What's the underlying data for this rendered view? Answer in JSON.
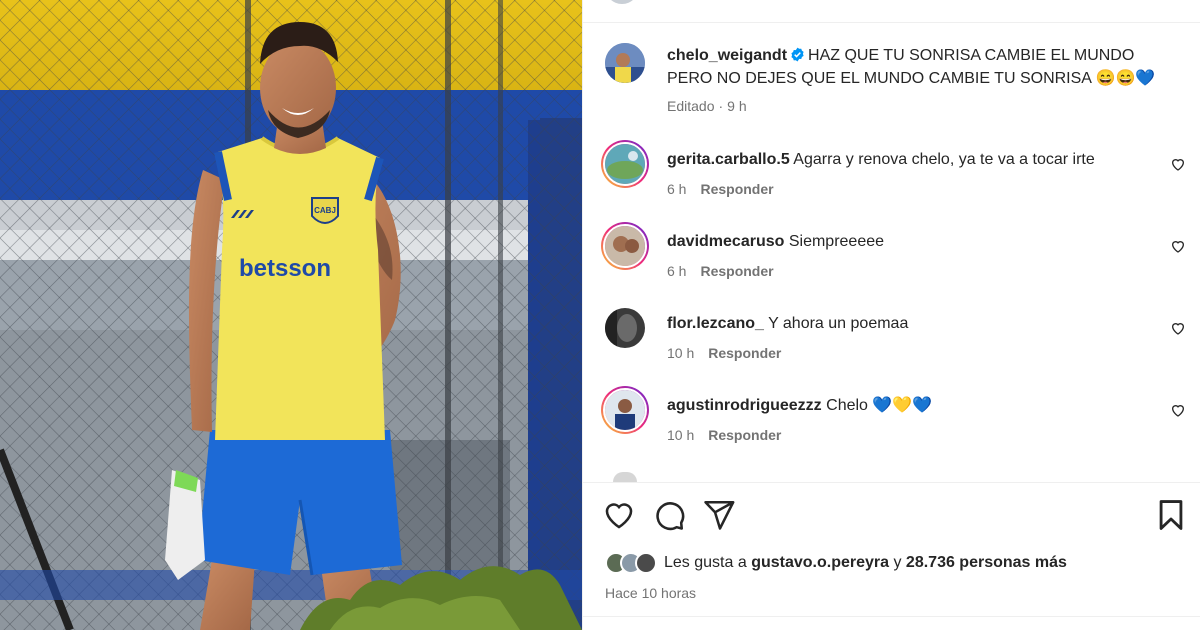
{
  "post": {
    "author": "chelo_weigandt",
    "caption": "HAZ QUE TU SONRISA CAMBIE EL MUNDO PERO NO DEJES QUE EL MUNDO CAMBIE TU SONRISA",
    "caption_emojis": "😄😄💙",
    "edited_label": "Editado",
    "edited_time": "9 h",
    "verified_color": "#0095f6"
  },
  "photo": {
    "shirt_sponsor": "betsson",
    "crest_text": "CABJ"
  },
  "comments": [
    {
      "user": "gerita.carballo.5",
      "text": "Agarra y renova chelo, ya te va a tocar irte",
      "time": "6 h",
      "reply": "Responder"
    },
    {
      "user": "davidmecaruso",
      "text": "Siempreeeee",
      "time": "6 h",
      "reply": "Responder"
    },
    {
      "user": "flor.lezcano_",
      "text": "Y ahora un poemaa",
      "time": "10 h",
      "reply": "Responder"
    },
    {
      "user": "agustinrodrigueezzz",
      "text": "Chelo",
      "emojis": "💙💛💙",
      "time": "10 h",
      "reply": "Responder"
    }
  ],
  "likes": {
    "prefix": "Les gusta a",
    "user": "gustavo.o.pereyra",
    "middle": "y",
    "count": "28.736 personas más"
  },
  "posted_time": "Hace 10 horas",
  "icons": {
    "like": "heart-icon",
    "comment": "comment-icon",
    "share": "share-icon",
    "save": "bookmark-icon"
  }
}
